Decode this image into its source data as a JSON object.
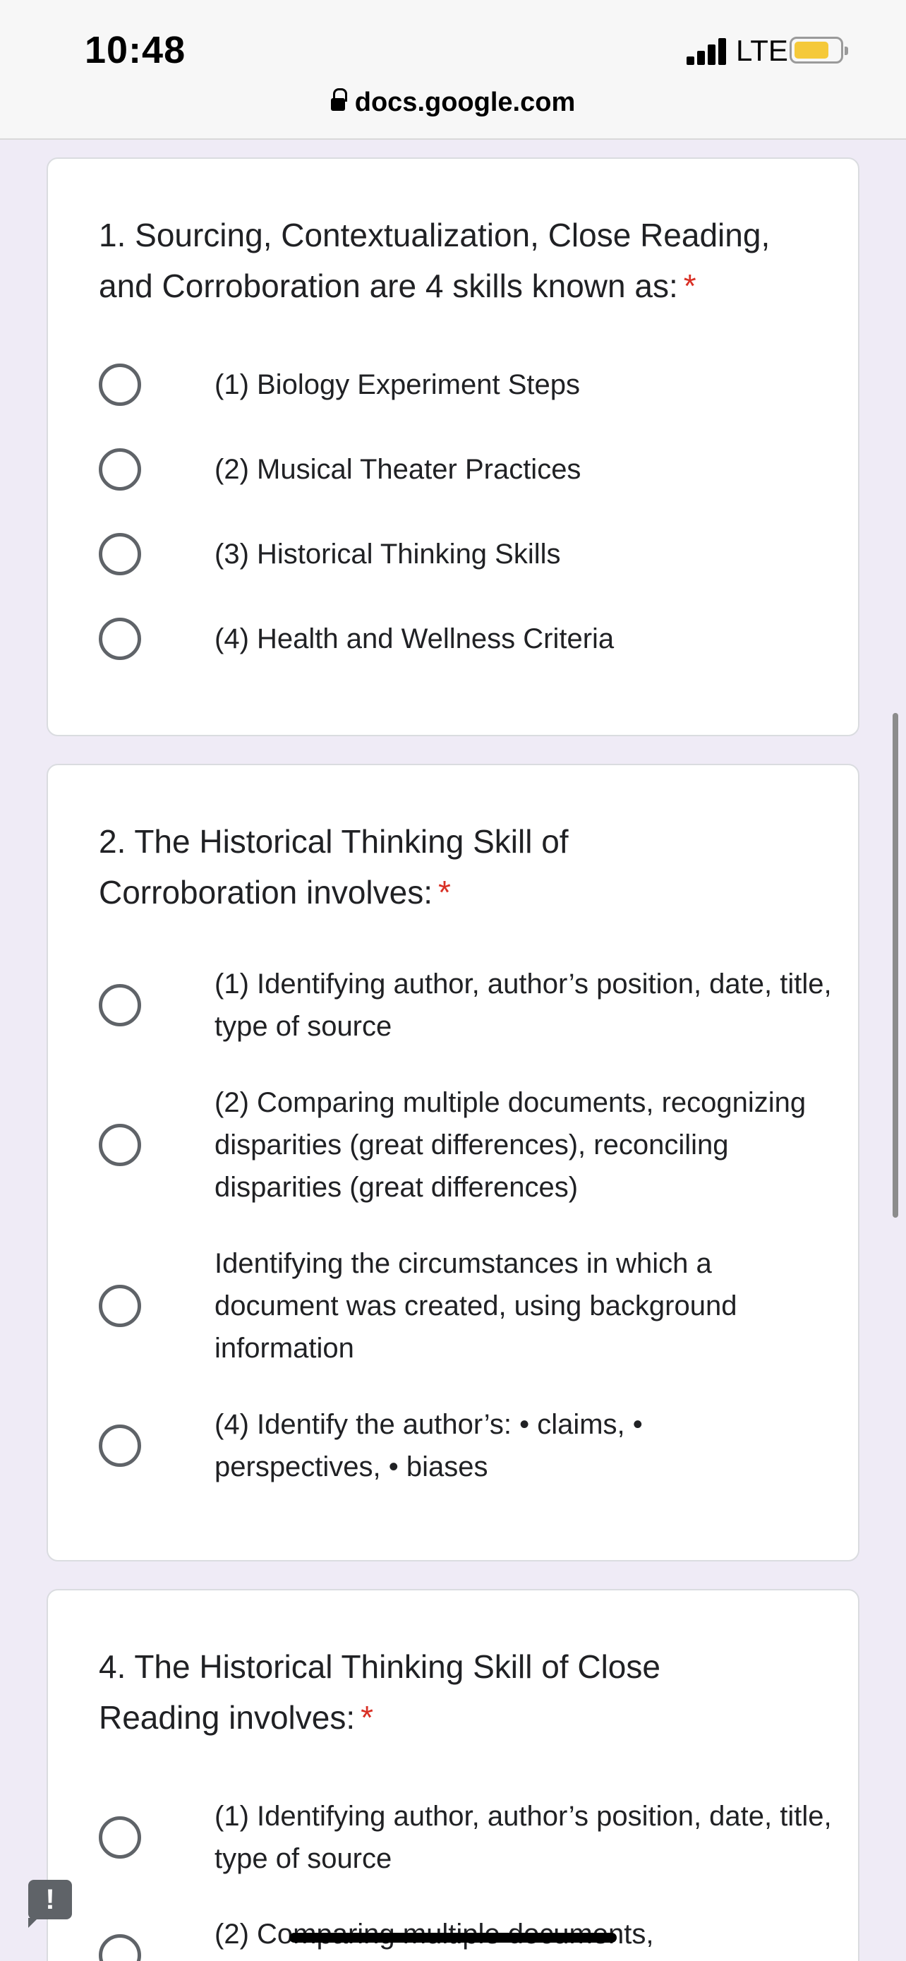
{
  "status_bar": {
    "time": "10:48",
    "network": "LTE",
    "battery_color": "#f5c93a"
  },
  "browser": {
    "url": "docs.google.com",
    "lock_icon": "lock-icon"
  },
  "form": {
    "required_mark": "*",
    "questions": [
      {
        "title": "1. Sourcing, Contextualization, Close Reading, and Corroboration are 4 skills known as:",
        "options": [
          "(1) Biology Experiment Steps",
          "(2) Musical Theater Practices",
          "(3) Historical Thinking Skills",
          "(4) Health and Wellness Criteria"
        ]
      },
      {
        "title": "2. The Historical Thinking Skill of Corroboration involves:",
        "options": [
          "(1) Identifying author, author’s position, date, title, type of source",
          "(2) Comparing multiple documents, recognizing disparities (great differences), reconciling disparities (great differences)",
          "Identifying the circumstances in which a document was created, using background information",
          "(4) Identify the author’s: • claims, • perspectives, • biases"
        ]
      },
      {
        "title": "4. The Historical Thinking Skill of Close Reading involves:",
        "options": [
          "(1) Identifying author, author’s position, date, title, type of source",
          "(2) Comparing multiple documents,"
        ]
      }
    ]
  },
  "feedback_button": {
    "label": "!"
  },
  "colors": {
    "page_background": "#efebf6",
    "required_asterisk": "#d93025",
    "radio_border": "#5f6368"
  }
}
